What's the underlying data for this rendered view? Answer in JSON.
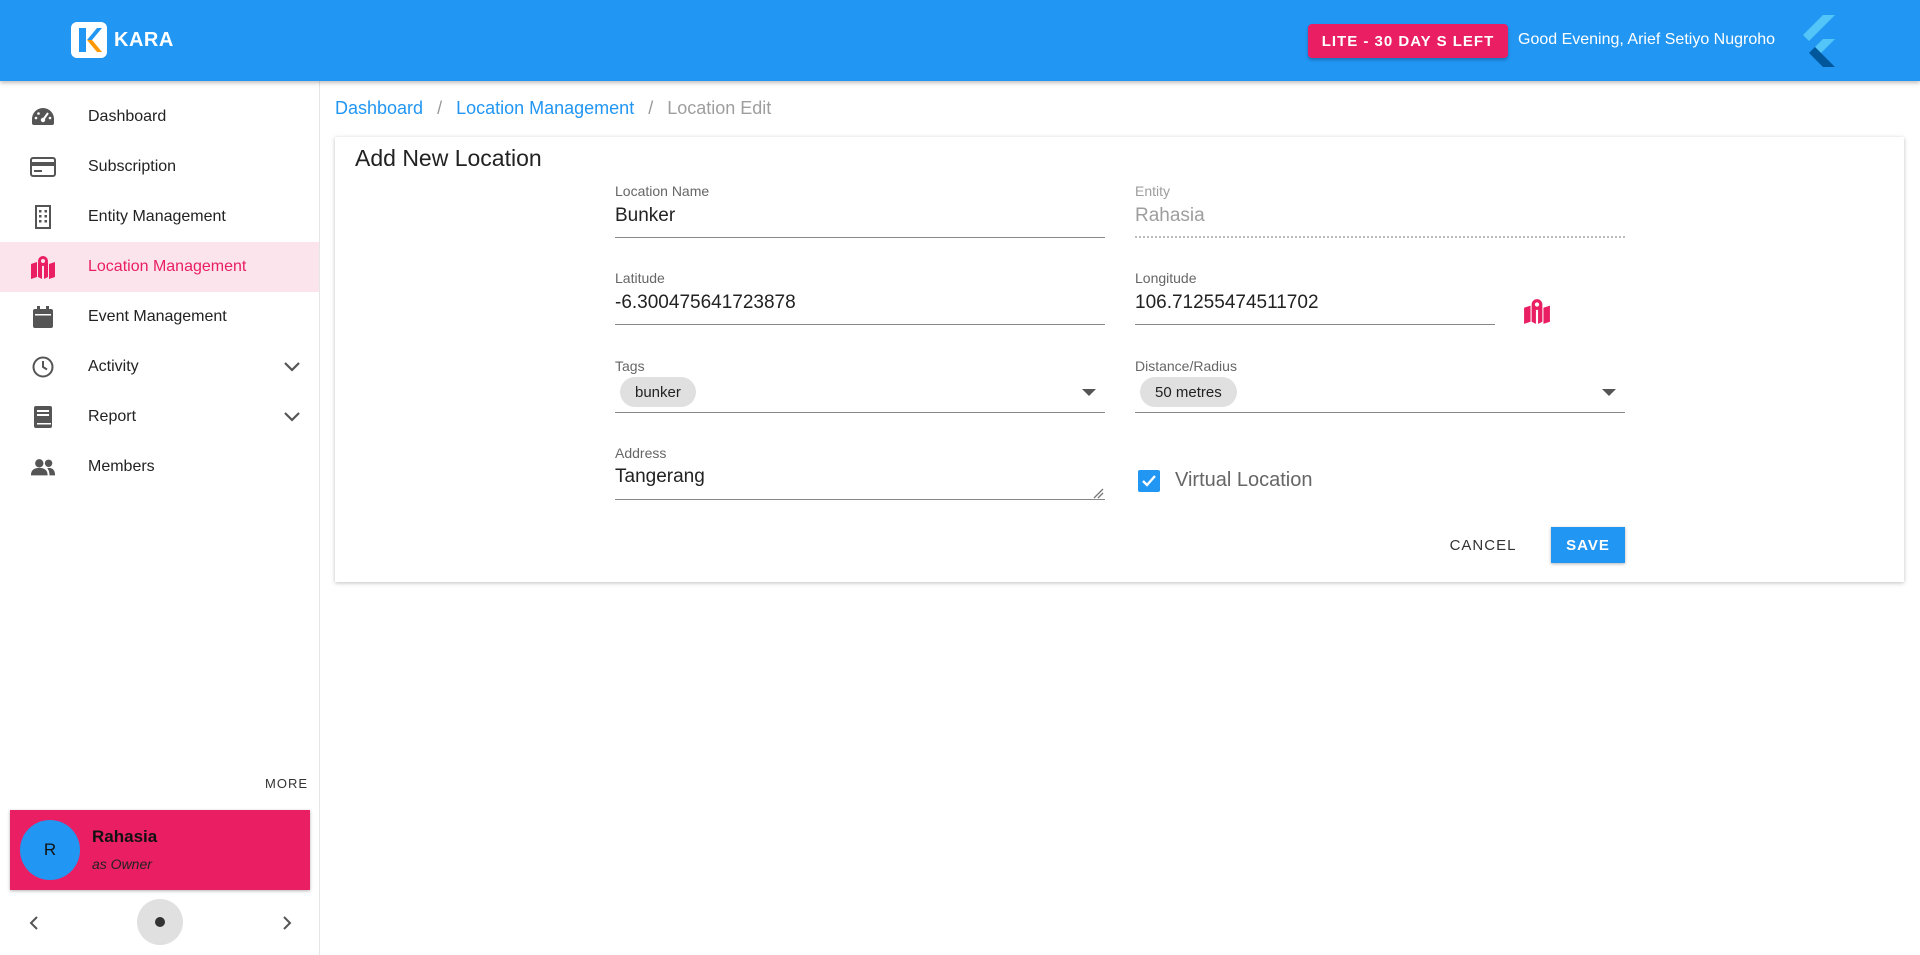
{
  "header": {
    "brand": "KARA",
    "badge": "LITE - 30 DAY S LEFT",
    "greeting": "Good Evening, Arief Setiyo Nugroho",
    "colors": {
      "primary": "#2196f3",
      "accent": "#e91e63"
    }
  },
  "sidebar": {
    "items": [
      {
        "label": "Dashboard",
        "icon": "speedometer-icon"
      },
      {
        "label": "Subscription",
        "icon": "credit-card-icon"
      },
      {
        "label": "Entity Management",
        "icon": "building-icon"
      },
      {
        "label": "Location Management",
        "icon": "map-marker-icon",
        "active": true
      },
      {
        "label": "Event Management",
        "icon": "calendar-icon"
      },
      {
        "label": "Activity",
        "icon": "clock-icon",
        "expandable": true
      },
      {
        "label": "Report",
        "icon": "book-icon",
        "expandable": true
      },
      {
        "label": "Members",
        "icon": "people-icon"
      }
    ],
    "more": "MORE",
    "user": {
      "initial": "R",
      "name": "Rahasia",
      "role": "as Owner"
    }
  },
  "breadcrumb": {
    "items": [
      "Dashboard",
      "Location Management"
    ],
    "current": "Location Edit",
    "separator": "/"
  },
  "form": {
    "title": "Add New Location",
    "location_name": {
      "label": "Location Name",
      "value": "Bunker"
    },
    "entity": {
      "label": "Entity",
      "value": "Rahasia"
    },
    "latitude": {
      "label": "Latitude",
      "value": "-6.300475641723878"
    },
    "longitude": {
      "label": "Longitude",
      "value": "106.71255474511702"
    },
    "tags": {
      "label": "Tags",
      "chip": "bunker"
    },
    "radius": {
      "label": "Distance/Radius",
      "chip": "50 metres"
    },
    "address": {
      "label": "Address",
      "value": "Tangerang"
    },
    "virtual_location": {
      "label": "Virtual Location",
      "checked": true
    },
    "cancel_label": "CANCEL",
    "save_label": "SAVE"
  }
}
